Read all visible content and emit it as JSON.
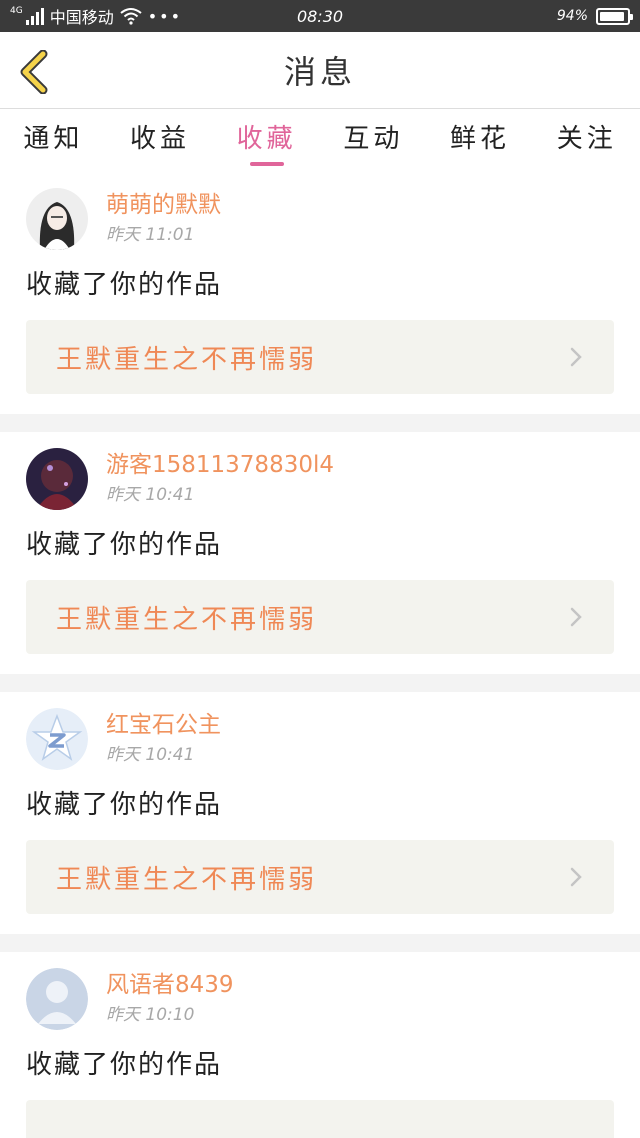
{
  "status_bar": {
    "network": "4G",
    "carrier": "中国移动",
    "more": "•••",
    "time": "08:30",
    "battery_percent": "94%",
    "battery_level": 0.94
  },
  "header": {
    "title": "消息"
  },
  "tabs": [
    {
      "label": "通知",
      "active": false
    },
    {
      "label": "收益",
      "active": false
    },
    {
      "label": "收藏",
      "active": true
    },
    {
      "label": "互动",
      "active": false
    },
    {
      "label": "鲜花",
      "active": false
    },
    {
      "label": "关注",
      "active": false
    }
  ],
  "feed": [
    {
      "username": "萌萌的默默",
      "time": "昨天 11:01",
      "action": "收藏了你的作品",
      "work_title": "王默重生之不再懦弱",
      "avatar_icon": "girl-portrait-avatar"
    },
    {
      "username": "游客15811378830l4",
      "time": "昨天 10:41",
      "action": "收藏了你的作品",
      "work_title": "王默重生之不再懦弱",
      "avatar_icon": "dark-anime-avatar"
    },
    {
      "username": "红宝石公主",
      "time": "昨天 10:41",
      "action": "收藏了你的作品",
      "work_title": "王默重生之不再懦弱",
      "avatar_icon": "star-logo-avatar"
    },
    {
      "username": "风语者8439",
      "time": "昨天 10:10",
      "action": "收藏了你的作品",
      "work_title": "",
      "avatar_icon": "default-person-avatar"
    }
  ],
  "colors": {
    "accent": "#e0659a",
    "username": "#f0935e",
    "work_title": "#ef8855",
    "back_arrow": "#f5d34a"
  }
}
